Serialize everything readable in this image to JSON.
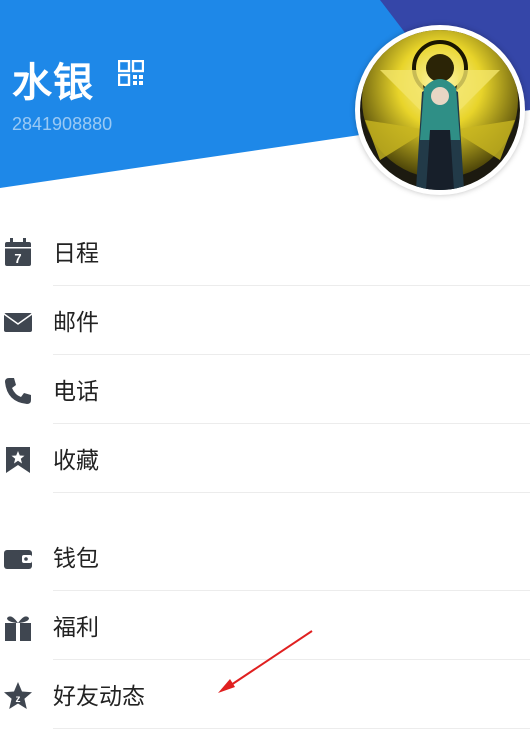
{
  "header": {
    "user_name": "水银",
    "user_id": "2841908880"
  },
  "colors": {
    "header_blue": "#1e88e8",
    "header_dark": "#3546a8",
    "icon_gray": "#3f4650",
    "annotation_arrow": "#e02020"
  },
  "menu": {
    "items": [
      {
        "label": "日程",
        "icon": "calendar-icon"
      },
      {
        "label": "邮件",
        "icon": "mail-icon"
      },
      {
        "label": "电话",
        "icon": "phone-icon"
      },
      {
        "label": "收藏",
        "icon": "favorites-icon"
      },
      {
        "label": "钱包",
        "icon": "wallet-icon"
      },
      {
        "label": "福利",
        "icon": "gift-icon"
      },
      {
        "label": "好友动态",
        "icon": "qzone-star-icon"
      }
    ]
  }
}
